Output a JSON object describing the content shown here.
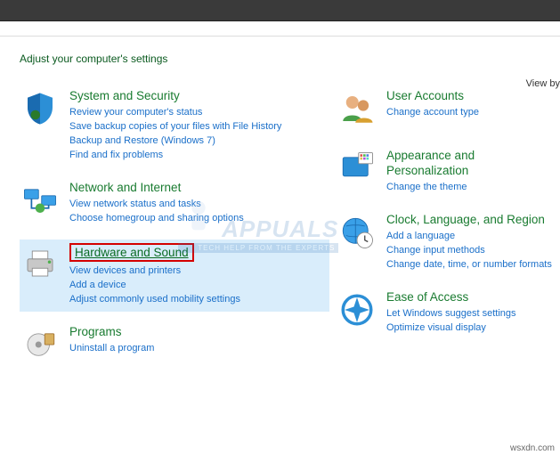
{
  "header": {
    "title": "Adjust your computer's settings",
    "view_by": "View by"
  },
  "left_categories": [
    {
      "id": "system-security",
      "title": "System and Security",
      "links": [
        "Review your computer's status",
        "Save backup copies of your files with File History",
        "Backup and Restore (Windows 7)",
        "Find and fix problems"
      ]
    },
    {
      "id": "network-internet",
      "title": "Network and Internet",
      "links": [
        "View network status and tasks",
        "Choose homegroup and sharing options"
      ]
    },
    {
      "id": "hardware-sound",
      "title": "Hardware and Sound",
      "boxed": true,
      "selected": true,
      "links": [
        "View devices and printers",
        "Add a device",
        "Adjust commonly used mobility settings"
      ]
    },
    {
      "id": "programs",
      "title": "Programs",
      "links": [
        "Uninstall a program"
      ]
    }
  ],
  "right_categories": [
    {
      "id": "user-accounts",
      "title": "User Accounts",
      "links": [
        "Change account type"
      ]
    },
    {
      "id": "appearance",
      "title": "Appearance and Personalization",
      "links": [
        "Change the theme"
      ]
    },
    {
      "id": "clock-language-region",
      "title": "Clock, Language, and Region",
      "links": [
        "Add a language",
        "Change input methods",
        "Change date, time, or number formats"
      ]
    },
    {
      "id": "ease-of-access",
      "title": "Ease of Access",
      "links": [
        "Let Windows suggest settings",
        "Optimize visual display"
      ]
    }
  ],
  "watermark": {
    "brand": "APPUALS",
    "tag": "TECH HELP FROM THE EXPERTS"
  },
  "source": "wsxdn.com"
}
